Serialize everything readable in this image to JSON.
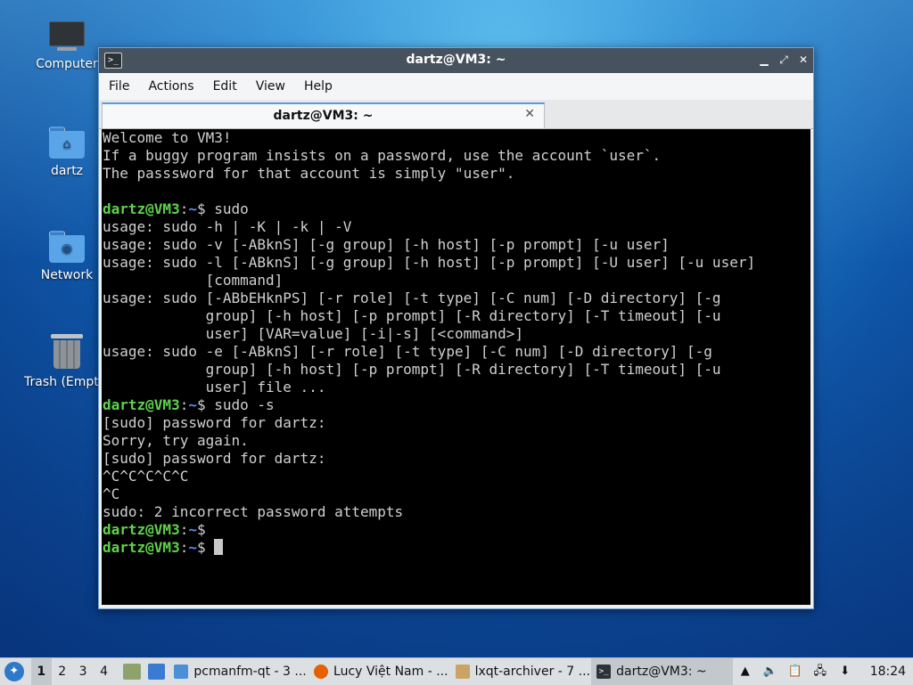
{
  "desktop": {
    "icons": [
      {
        "label": "Computer"
      },
      {
        "label": "dartz"
      },
      {
        "label": "Network"
      },
      {
        "label": "Trash (Empty)"
      }
    ]
  },
  "window": {
    "title": "dartz@VM3: ~",
    "menu": [
      "File",
      "Actions",
      "Edit",
      "View",
      "Help"
    ],
    "tab_label": "dartz@VM3: ~",
    "prompt_user": "dartz@VM3",
    "prompt_sep": ":",
    "prompt_path": "~",
    "terminal_lines": [
      {
        "type": "text",
        "text": "Welcome to VM3!"
      },
      {
        "type": "text",
        "text": "If a buggy program insists on a password, use the account `user`."
      },
      {
        "type": "text",
        "text": "The passsword for that account is simply \"user\"."
      },
      {
        "type": "text",
        "text": ""
      },
      {
        "type": "prompt",
        "cmd": " sudo"
      },
      {
        "type": "text",
        "text": "usage: sudo -h | -K | -k | -V"
      },
      {
        "type": "text",
        "text": "usage: sudo -v [-ABknS] [-g group] [-h host] [-p prompt] [-u user]"
      },
      {
        "type": "text",
        "text": "usage: sudo -l [-ABknS] [-g group] [-h host] [-p prompt] [-U user] [-u user]"
      },
      {
        "type": "text",
        "text": "            [command]"
      },
      {
        "type": "text",
        "text": "usage: sudo [-ABbEHknPS] [-r role] [-t type] [-C num] [-D directory] [-g"
      },
      {
        "type": "text",
        "text": "            group] [-h host] [-p prompt] [-R directory] [-T timeout] [-u"
      },
      {
        "type": "text",
        "text": "            user] [VAR=value] [-i|-s] [<command>]"
      },
      {
        "type": "text",
        "text": "usage: sudo -e [-ABknS] [-r role] [-t type] [-C num] [-D directory] [-g"
      },
      {
        "type": "text",
        "text": "            group] [-h host] [-p prompt] [-R directory] [-T timeout] [-u"
      },
      {
        "type": "text",
        "text": "            user] file ..."
      },
      {
        "type": "prompt",
        "cmd": " sudo -s"
      },
      {
        "type": "text",
        "text": "[sudo] password for dartz:"
      },
      {
        "type": "text",
        "text": "Sorry, try again."
      },
      {
        "type": "text",
        "text": "[sudo] password for dartz:"
      },
      {
        "type": "text",
        "text": "^C^C^C^C^C"
      },
      {
        "type": "text",
        "text": "^C"
      },
      {
        "type": "text",
        "text": "sudo: 2 incorrect password attempts"
      },
      {
        "type": "prompt",
        "cmd": ""
      },
      {
        "type": "prompt",
        "cmd": " ",
        "cursor": true
      }
    ]
  },
  "taskbar": {
    "workspaces": [
      "1",
      "2",
      "3",
      "4"
    ],
    "active_workspace": "1",
    "tasks": [
      {
        "label": "pcmanfm-qt - 3 ...",
        "icon": "folder-icon",
        "color": "#4a90d9"
      },
      {
        "label": "Lucy Việt Nam - ...",
        "icon": "firefox-icon",
        "color": "#e66000"
      },
      {
        "label": "lxqt-archiver - 7 ...",
        "icon": "archive-icon",
        "color": "#c9a466"
      },
      {
        "label": "dartz@VM3: ~",
        "icon": "terminal-icon",
        "color": "#2b3238",
        "active": true
      }
    ],
    "clock": "18:24"
  },
  "colors": {
    "prompt_user": "#5ed34a",
    "prompt_path": "#5c8cf0",
    "accent": "#5a9be0"
  }
}
